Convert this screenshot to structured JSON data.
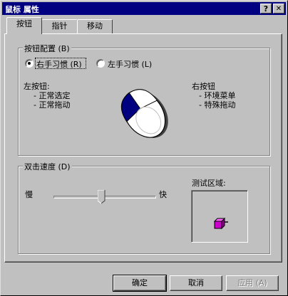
{
  "window": {
    "title": "鼠标 属性",
    "help_btn": "?",
    "close_btn": "✕"
  },
  "tabs": [
    {
      "label": "按钮"
    },
    {
      "label": "指针"
    },
    {
      "label": "移动"
    }
  ],
  "button_config": {
    "group_label": "按钮配置 (B)",
    "right_handed": "右手习惯 (R)",
    "left_handed": "左手习惯 (L)",
    "selected": "right_handed",
    "left_button_title": "左按钮:",
    "left_button_items": [
      "- 正常选定",
      "- 正常拖动"
    ],
    "right_button_title": "右按钮",
    "right_button_items": [
      "- 环境菜单",
      "- 特殊拖动"
    ]
  },
  "double_click": {
    "group_label": "双击速度 (D)",
    "slow": "慢",
    "fast": "快",
    "speed": 0.47,
    "test_area_label": "测试区域:"
  },
  "buttons": {
    "ok": "确定",
    "cancel": "取消",
    "apply": "应用 (A)"
  },
  "colors": {
    "titlebar": "#000080",
    "face": "#c0c0c0",
    "test_icon": "#cc00cc"
  }
}
